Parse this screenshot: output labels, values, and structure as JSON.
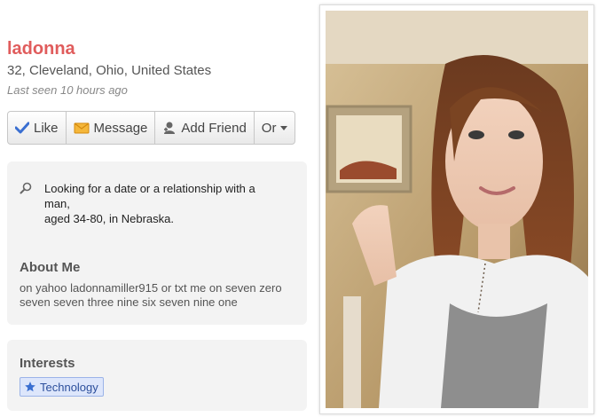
{
  "profile": {
    "name": "ladonna",
    "location": "32, Cleveland, Ohio, United States",
    "last_seen": "Last seen 10 hours ago"
  },
  "actions": {
    "like": "Like",
    "message": "Message",
    "add_friend": "Add Friend",
    "more": "Or"
  },
  "looking_for": {
    "line1": "Looking for a date or a relationship with a man,",
    "line2": "aged 34-80, in Nebraska."
  },
  "about": {
    "title": "About Me",
    "text": "on yahoo ladonnamiller915 or txt me on seven zero seven seven three nine six seven nine one"
  },
  "interests": {
    "title": "Interests",
    "items": [
      "Technology"
    ]
  },
  "colors": {
    "name": "#e05c5c",
    "like_icon": "#3a6fd1",
    "message_icon": "#f0a020",
    "tag_bg": "#dde6fb",
    "tag_border": "#9bb3e8"
  },
  "icons": [
    "check-icon",
    "envelope-icon",
    "person-add-icon",
    "caret-down-icon",
    "magnifier-icon",
    "star-icon"
  ]
}
